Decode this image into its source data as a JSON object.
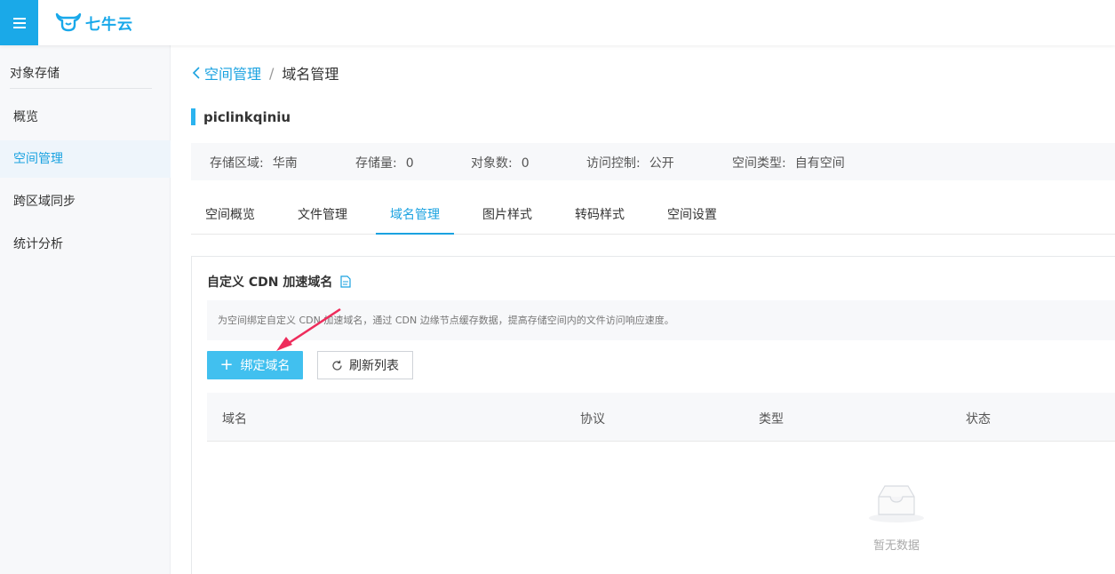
{
  "topbar": {
    "logo_text": "七牛云",
    "menu_icon": "hamburger-icon"
  },
  "sidebar": {
    "section_title": "对象存储",
    "items": [
      {
        "label": "概览"
      },
      {
        "label": "空间管理"
      },
      {
        "label": "跨区域同步"
      },
      {
        "label": "统计分析"
      }
    ],
    "active_index": 1
  },
  "breadcrumb": {
    "parent": "空间管理",
    "separator": "/",
    "current": "域名管理"
  },
  "bucket": {
    "name": "piclinkqiniu",
    "info": [
      {
        "label": "存储区域:",
        "value": "华南"
      },
      {
        "label": "存储量:",
        "value": "0"
      },
      {
        "label": "对象数:",
        "value": "0"
      },
      {
        "label": "访问控制:",
        "value": "公开"
      },
      {
        "label": "空间类型:",
        "value": "自有空间"
      }
    ]
  },
  "tabs": [
    {
      "label": "空间概览"
    },
    {
      "label": "文件管理"
    },
    {
      "label": "域名管理"
    },
    {
      "label": "图片样式"
    },
    {
      "label": "转码样式"
    },
    {
      "label": "空间设置"
    }
  ],
  "active_tab": 2,
  "cdn_panel": {
    "title": "自定义 CDN 加速域名",
    "description": "为空间绑定自定义 CDN 加速域名，通过 CDN 边缘节点缓存数据，提高存储空间内的文件访问响应速度。",
    "bind_button": "绑定域名",
    "refresh_button": "刷新列表",
    "columns": [
      "域名",
      "协议",
      "类型",
      "状态"
    ],
    "empty_text": "暂无数据"
  },
  "colors": {
    "accent": "#1aa2e0",
    "primary_button": "#41c0ef",
    "annotation_arrow": "#ee2d5c"
  }
}
